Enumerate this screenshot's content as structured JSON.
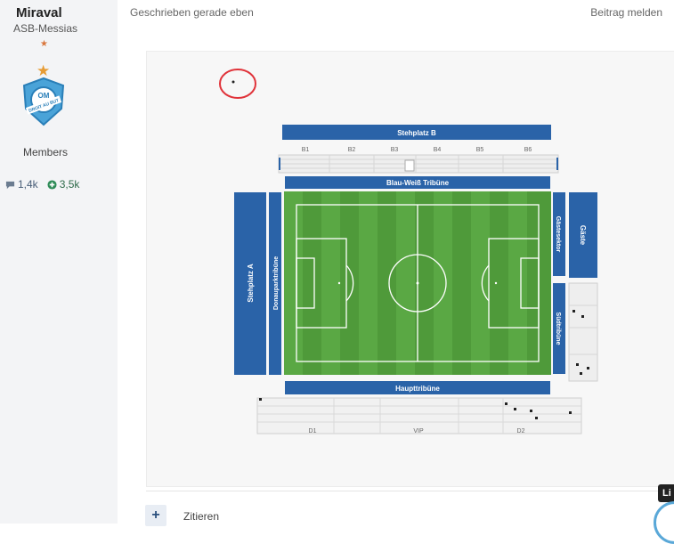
{
  "user": {
    "name": "Miraval",
    "title": "ASB-Messias",
    "group": "Members",
    "stats": [
      {
        "icon": "speech-bubble-icon",
        "value": "1,4k"
      },
      {
        "icon": "plus-circle-icon",
        "value": "3,5k"
      }
    ],
    "avatar_text": "DROIT AU BUT"
  },
  "post": {
    "meta": "Geschrieben gerade eben",
    "report": "Beitrag melden"
  },
  "stadium": {
    "stehplatz_b": "Stehplatz B",
    "blocks_top": [
      "B1",
      "B2",
      "B3",
      "B4",
      "B5",
      "B6"
    ],
    "blau_weiss": "Blau-Weiß Tribüne",
    "stehplatz_a": "Stehplatz A",
    "donaupark": "Donauparktribüne",
    "gaestesektor": "Gästesektor",
    "gaeste": "Gäste",
    "suedtribuene": "Südtribüne",
    "haupttribuene": "Haupttribüne",
    "blocks_bottom": [
      "D1",
      "VIP",
      "D2"
    ]
  },
  "actions": {
    "cite": "Zitieren",
    "tooltip": "Li"
  },
  "colors": {
    "stand_blue": "#2a63a8",
    "pitch_green": "#4f9a3a",
    "annotation_red": "#e0333a"
  }
}
